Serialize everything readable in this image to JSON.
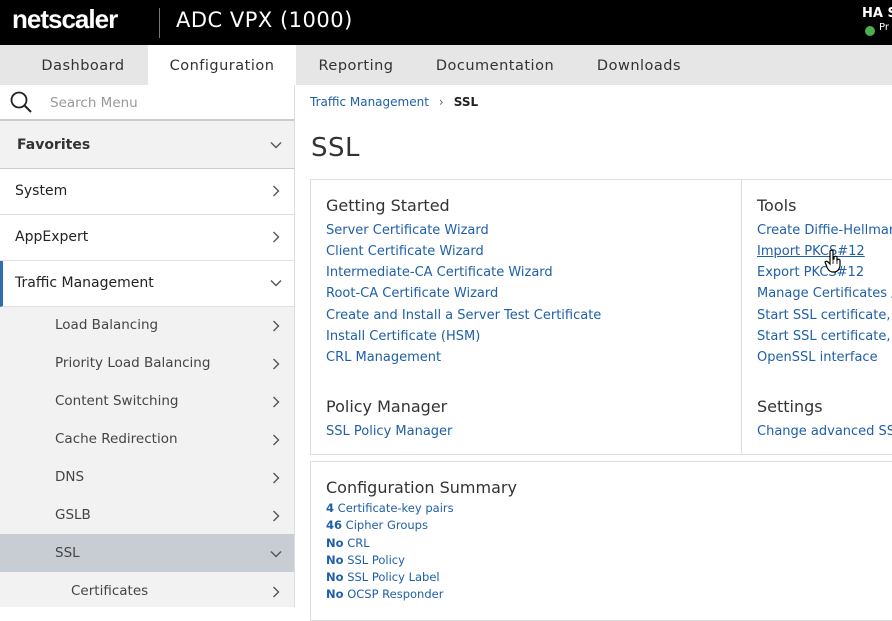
{
  "header": {
    "logo": "netscaler",
    "product": "ADC VPX (1000)",
    "ha_label": "HA S",
    "ha_state": "Pr",
    "ha_status_color": "#4caf50"
  },
  "tabs": [
    {
      "label": "Dashboard"
    },
    {
      "label": "Configuration"
    },
    {
      "label": "Reporting"
    },
    {
      "label": "Documentation"
    },
    {
      "label": "Downloads"
    }
  ],
  "sidebar": {
    "search_placeholder": "Search Menu",
    "favorites": "Favorites",
    "items": [
      {
        "label": "System"
      },
      {
        "label": "AppExpert"
      },
      {
        "label": "Traffic Management"
      }
    ],
    "subitems": [
      {
        "label": "Load Balancing"
      },
      {
        "label": "Priority Load Balancing"
      },
      {
        "label": "Content Switching"
      },
      {
        "label": "Cache Redirection"
      },
      {
        "label": "DNS"
      },
      {
        "label": "GSLB"
      },
      {
        "label": "SSL"
      },
      {
        "label": "Certificates"
      }
    ]
  },
  "breadcrumb": {
    "parent": "Traffic Management",
    "current": "SSL"
  },
  "page_title": "SSL",
  "getting_started": {
    "title": "Getting Started",
    "links": [
      "Server Certificate Wizard",
      "Client Certificate Wizard",
      "Intermediate-CA Certificate Wizard",
      "Root-CA Certificate Wizard",
      "Create and Install a Server Test Certificate",
      "Install Certificate (HSM)",
      "CRL Management"
    ]
  },
  "tools": {
    "title": "Tools",
    "links": [
      "Create Diffie-Hellman",
      "Import PKCS#12",
      "Export PKCS#12",
      "Manage Certificates /",
      "Start SSL certificate, l",
      "Start SSL certificate, l",
      "OpenSSL interface"
    ]
  },
  "policy_manager": {
    "title": "Policy Manager",
    "link": "SSL Policy Manager"
  },
  "settings": {
    "title": "Settings",
    "link": "Change advanced SS"
  },
  "config_summary": {
    "title": "Configuration Summary",
    "lines": [
      {
        "value": "4",
        "text": "Certificate-key pairs"
      },
      {
        "value": "46",
        "text": "Cipher Groups"
      },
      {
        "value": "No",
        "text": "CRL"
      },
      {
        "value": "No",
        "text": "SSL Policy"
      },
      {
        "value": "No",
        "text": "SSL Policy Label"
      },
      {
        "value": "No",
        "text": "OCSP Responder"
      }
    ]
  }
}
